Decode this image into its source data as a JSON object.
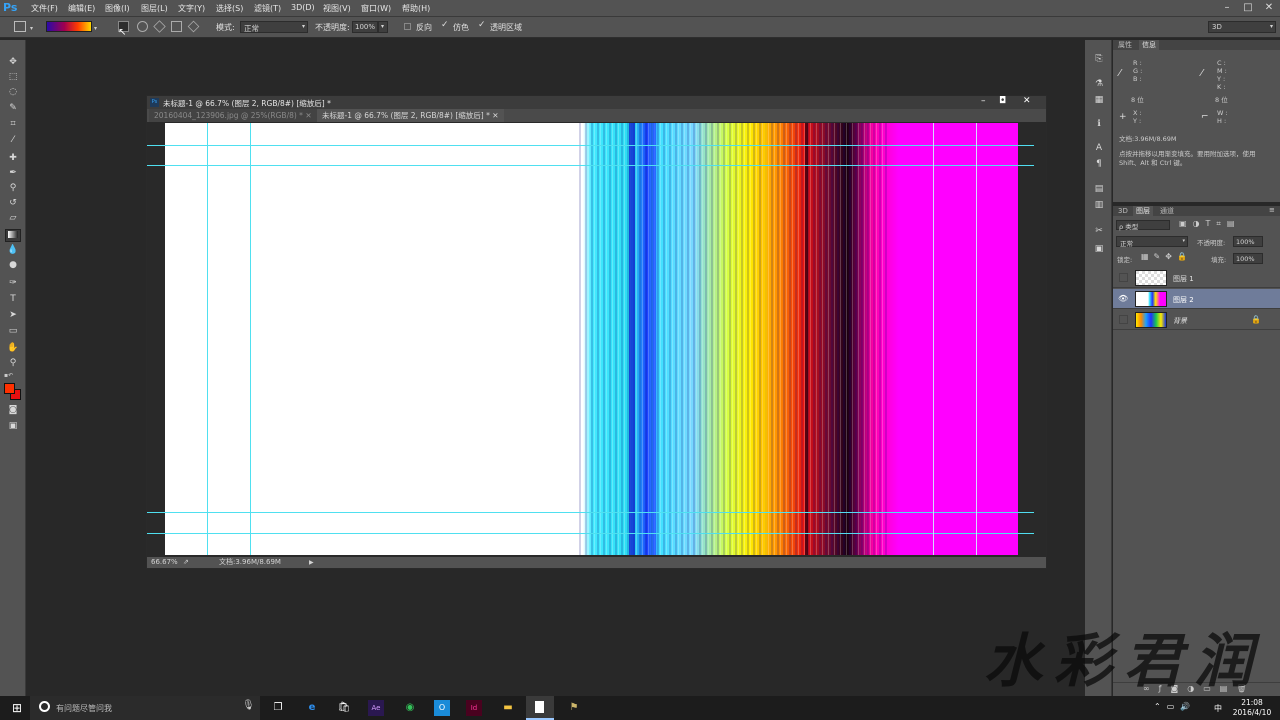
{
  "app": {
    "logo": "Ps"
  },
  "menu": [
    "文件(F)",
    "编辑(E)",
    "图像(I)",
    "图层(L)",
    "文字(Y)",
    "选择(S)",
    "滤镜(T)",
    "3D(D)",
    "视图(V)",
    "窗口(W)",
    "帮助(H)"
  ],
  "options": {
    "mode_label": "模式:",
    "mode_value": "正常",
    "opacity_label": "不透明度:",
    "opacity_value": "100%",
    "reverse_label": "反向",
    "dither_label": "仿色",
    "transparency_label": "透明区域",
    "workspace": "3D"
  },
  "document": {
    "title": "未标题-1 @ 66.7% (图层 2, RGB/8#) [缩放后] *",
    "tabs": [
      "20160404_123906.jpg @ 25%(RGB/8) *",
      "未标题-1 @ 66.7% (图层 2, RGB/8#) [缩放后] *"
    ],
    "zoom": "66.67%",
    "doc_size": "文档:3.96M/8.69M"
  },
  "info_panel": {
    "tabs": [
      "属性",
      "信息"
    ],
    "rgb_labels": [
      "R :",
      "G :",
      "B :"
    ],
    "cmyk_labels": [
      "C :",
      "M :",
      "Y :",
      "K :"
    ],
    "bit_left": "8 位",
    "bit_right": "8 位",
    "xy_labels": [
      "X :",
      "Y :"
    ],
    "wh_labels": [
      "W :",
      "H :"
    ],
    "doc_size": "文档:3.96M/8.69M",
    "hint": "点按并拖移以用渐变填充。要用附加选项，使用 Shift、Alt 和 Ctrl 键。"
  },
  "layers_panel": {
    "tabs": [
      "3D",
      "图层",
      "通道"
    ],
    "filter_label": "ρ 类型",
    "blend_mode": "正常",
    "opacity_label": "不透明度:",
    "opacity_value": "100%",
    "lock_label": "锁定:",
    "fill_label": "填充:",
    "fill_value": "100%",
    "layers": [
      {
        "name": "图层 1",
        "visible": false,
        "selected": false
      },
      {
        "name": "图层 2",
        "visible": true,
        "selected": true
      },
      {
        "name": "背景",
        "visible": false,
        "selected": false
      }
    ]
  },
  "taskbar": {
    "search_placeholder": "有问题尽管问我",
    "time": "21:08",
    "date": "2016/4/10",
    "ime": "中"
  },
  "watermark": "水彩君润"
}
